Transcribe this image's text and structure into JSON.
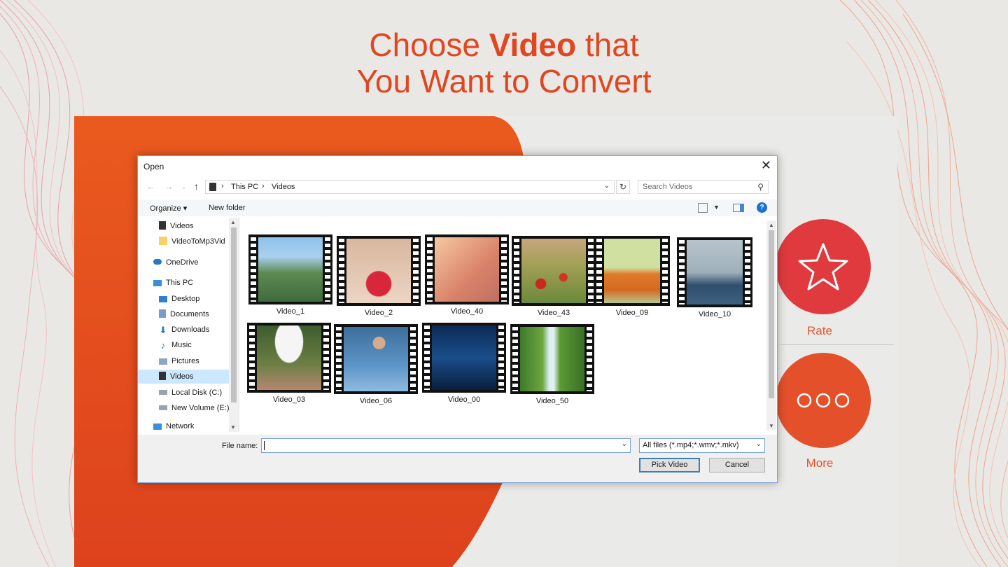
{
  "headline": {
    "line1_pre": "Choose ",
    "line1_bold": "Video",
    "line1_post": " that",
    "line2": "You Want to Convert"
  },
  "side_actions": {
    "rate_label": "Rate",
    "more_label": "More"
  },
  "colors": {
    "accent": "#e0461f",
    "rate": "#e03a3e",
    "more": "#e4502a",
    "dialog_border": "#7aa3d6"
  },
  "dialog": {
    "title": "Open",
    "address": {
      "crumbs": [
        "This PC",
        "Videos"
      ]
    },
    "search_placeholder": "Search Videos",
    "toolbar": {
      "organize": "Organize ▾",
      "new_folder": "New folder"
    },
    "nav_items": [
      {
        "label": "Videos",
        "icon": "video-folder-icon"
      },
      {
        "label": "VideoToMp3Vid",
        "icon": "folder-icon"
      },
      {
        "label": "OneDrive",
        "icon": "cloud-icon"
      },
      {
        "label": "This PC",
        "icon": "computer-icon"
      },
      {
        "label": "Desktop",
        "icon": "desktop-icon"
      },
      {
        "label": "Documents",
        "icon": "documents-icon"
      },
      {
        "label": "Downloads",
        "icon": "downloads-icon"
      },
      {
        "label": "Music",
        "icon": "music-icon"
      },
      {
        "label": "Pictures",
        "icon": "pictures-icon"
      },
      {
        "label": "Videos",
        "icon": "video-folder-icon",
        "selected": true
      },
      {
        "label": "Local Disk (C:)",
        "icon": "drive-icon"
      },
      {
        "label": "New Volume (E:)",
        "icon": "drive-icon"
      },
      {
        "label": "Network",
        "icon": "network-icon"
      }
    ],
    "files": [
      {
        "name": "Video_1",
        "thumb": "mountain-valley"
      },
      {
        "name": "Video_2",
        "thumb": "flower-petals-hands"
      },
      {
        "name": "Video_40",
        "thumb": "girl-brick-wall"
      },
      {
        "name": "Video_43",
        "thumb": "poppy-field"
      },
      {
        "name": "Video_09",
        "thumb": "orange-suitcase"
      },
      {
        "name": "Video_10",
        "thumb": "wakeboarder"
      },
      {
        "name": "Video_03",
        "thumb": "girls-umbrella"
      },
      {
        "name": "Video_06",
        "thumb": "woman-wind"
      },
      {
        "name": "Video_00",
        "thumb": "city-skyscrapers"
      },
      {
        "name": "Video_50",
        "thumb": "waterfall"
      }
    ],
    "file_name_label": "File name:",
    "file_name_value": "",
    "filter": "All files (*.mp4;*.wmv;*.mkv)",
    "buttons": {
      "pick": "Pick Video",
      "cancel": "Cancel"
    }
  }
}
